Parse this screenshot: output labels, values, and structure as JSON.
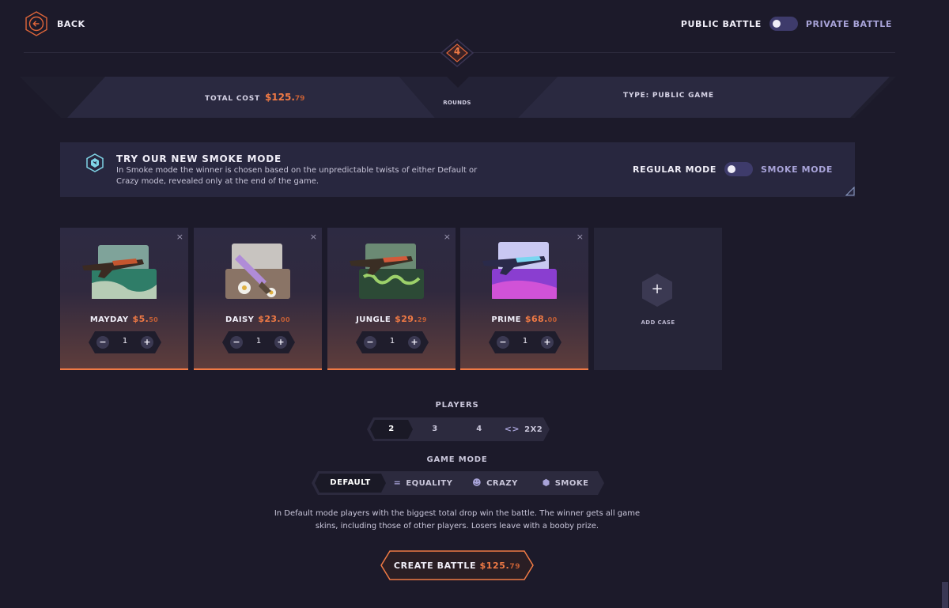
{
  "header": {
    "back_label": "BACK",
    "public_label": "PUBLIC BATTLE",
    "private_label": "PRIVATE BATTLE"
  },
  "summary": {
    "cost_label": "TOTAL COST",
    "cost_main": "$125.",
    "cost_cents": "79",
    "rounds_value": "4",
    "rounds_label": "ROUNDS",
    "type_label": "TYPE: PUBLIC GAME"
  },
  "promo": {
    "title": "TRY OUR NEW SMOKE MODE",
    "description": "In Smoke mode the winner is chosen based on the unpredictable twists of either Default or Crazy mode, revealed only at the end of the game.",
    "regular_label": "REGULAR MODE",
    "smoke_label": "SMOKE MODE"
  },
  "cases": [
    {
      "name": "MAYDAY",
      "price_main": "$5.",
      "price_cents": "50",
      "quantity": "1",
      "minus": "−",
      "plus": "+",
      "close": "×"
    },
    {
      "name": "DAISY",
      "price_main": "$23.",
      "price_cents": "00",
      "quantity": "1",
      "minus": "−",
      "plus": "+",
      "close": "×"
    },
    {
      "name": "JUNGLE",
      "price_main": "$29.",
      "price_cents": "29",
      "quantity": "1",
      "minus": "−",
      "plus": "+",
      "close": "×"
    },
    {
      "name": "PRIME",
      "price_main": "$68.",
      "price_cents": "00",
      "quantity": "1",
      "minus": "−",
      "plus": "+",
      "close": "×"
    }
  ],
  "add_case": {
    "icon": "+",
    "label": "ADD CASE"
  },
  "players": {
    "label": "PLAYERS",
    "options": [
      "2",
      "3",
      "4",
      "2X2"
    ],
    "selected": "2"
  },
  "game_mode": {
    "label": "GAME MODE",
    "options": [
      "DEFAULT",
      "EQUALITY",
      "CRAZY",
      "SMOKE"
    ],
    "selected": "DEFAULT",
    "description_line1": "In Default mode players with the biggest total drop win the battle. The winner gets all game",
    "description_line2": "skins, including those of other players. Losers leave with a booby prize."
  },
  "create": {
    "label": "CREATE BATTLE",
    "price_main": "$125.",
    "price_cents": "79"
  },
  "colors": {
    "accent": "#f07a45",
    "background": "#1c1a2a",
    "panel": "#28273f",
    "toggle": "#3e3b6b"
  }
}
